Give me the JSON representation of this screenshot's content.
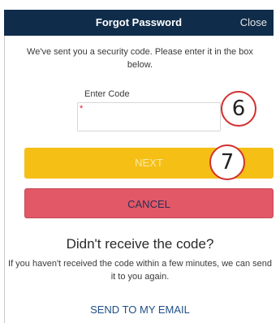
{
  "header": {
    "title": "Forgot Password",
    "close_label": "Close",
    "bg_color": "#0f2c4a"
  },
  "instruction": "We've sent you a security code. Please enter it in the box below.",
  "code_field": {
    "label": "Enter Code",
    "required_mark": "*",
    "value": "",
    "placeholder": ""
  },
  "annotations": {
    "step_6": "6",
    "step_7": "7"
  },
  "buttons": {
    "next_label": "NEXT",
    "cancel_label": "CANCEL",
    "next_color": "#f5bf16",
    "cancel_color": "#e25866"
  },
  "resend": {
    "heading": "Didn't receive the code?",
    "text": "If you haven't received the code within a few minutes, we can send it to you again.",
    "email_link": "SEND TO MY EMAIL"
  }
}
